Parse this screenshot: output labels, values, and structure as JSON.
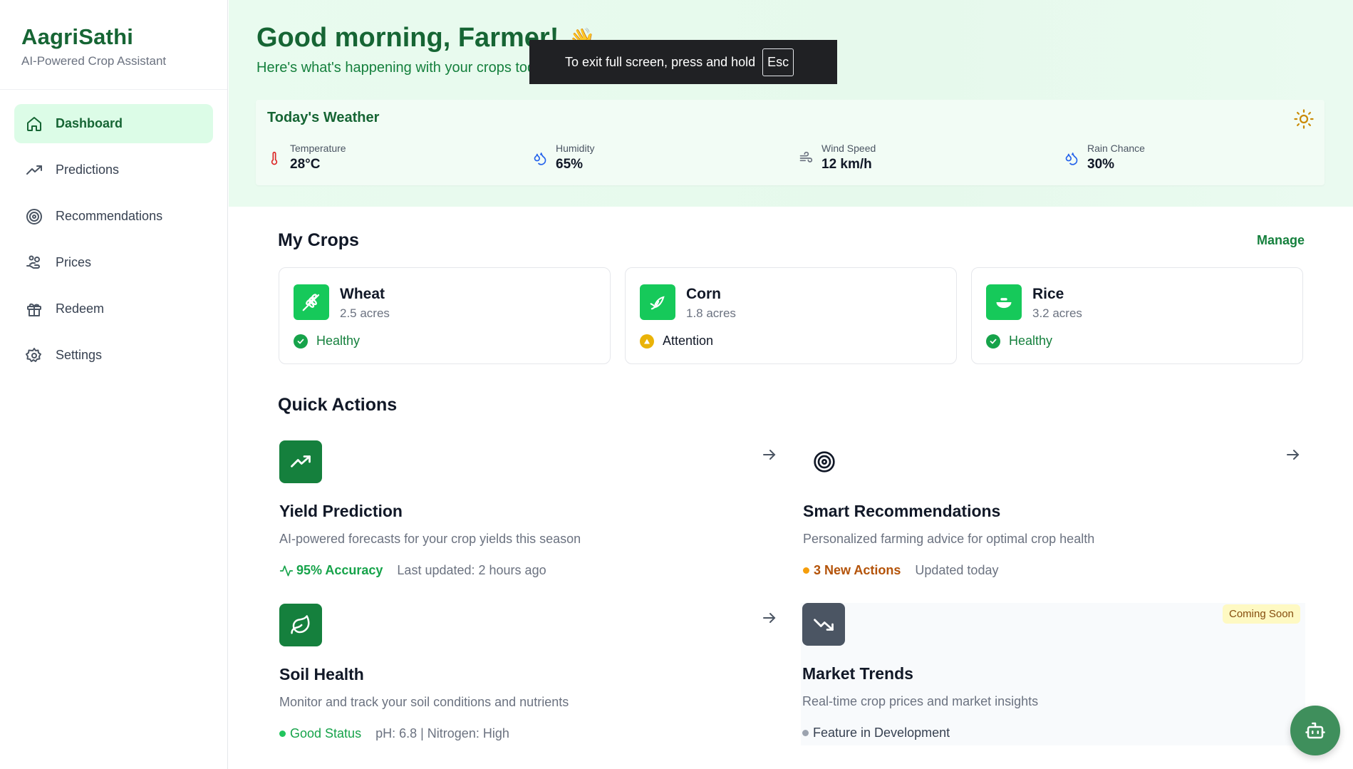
{
  "brand": {
    "name": "AagriSathi",
    "tagline": "AI-Powered Crop Assistant"
  },
  "nav": {
    "items": [
      {
        "label": "Dashboard",
        "icon": "home-icon",
        "active": true
      },
      {
        "label": "Predictions",
        "icon": "trending-up-icon"
      },
      {
        "label": "Recommendations",
        "icon": "target-icon"
      },
      {
        "label": "Prices",
        "icon": "hand-coins-icon"
      },
      {
        "label": "Redeem",
        "icon": "gift-icon"
      },
      {
        "label": "Settings",
        "icon": "gear-icon"
      }
    ]
  },
  "header": {
    "greeting": "Good morning, Farmer!",
    "wave": "👋",
    "subtitle": "Here's what's happening with your crops today"
  },
  "toast": {
    "text": "To exit full screen, press and hold",
    "key": "Esc"
  },
  "weather": {
    "title": "Today's Weather",
    "icon": "sun-icon",
    "stats": [
      {
        "label": "Temperature",
        "value": "28°C",
        "icon": "thermometer-icon",
        "color": "#dc2626"
      },
      {
        "label": "Humidity",
        "value": "65%",
        "icon": "droplets-icon",
        "color": "#2563eb"
      },
      {
        "label": "Wind Speed",
        "value": "12 km/h",
        "icon": "wind-icon",
        "color": "#6b7280"
      },
      {
        "label": "Rain Chance",
        "value": "30%",
        "icon": "droplets-icon",
        "color": "#2563eb"
      }
    ]
  },
  "crops": {
    "title": "My Crops",
    "manage": "Manage",
    "items": [
      {
        "name": "Wheat",
        "size": "2.5 acres",
        "status": "Healthy",
        "icon": "wheat-icon"
      },
      {
        "name": "Corn",
        "size": "1.8 acres",
        "status": "Attention",
        "icon": "corn-icon"
      },
      {
        "name": "Rice",
        "size": "3.2 acres",
        "status": "Healthy",
        "icon": "rice-bowl-icon"
      }
    ]
  },
  "quick_actions": {
    "title": "Quick Actions",
    "items": [
      {
        "title": "Yield Prediction",
        "desc": "AI-powered forecasts for your crop yields this season",
        "primary": "95% Accuracy",
        "secondary": "Last updated: 2 hours ago",
        "icon": "trending-up-icon"
      },
      {
        "title": "Smart Recommendations",
        "desc": "Personalized farming advice for optimal crop health",
        "primary": "3 New Actions",
        "secondary": "Updated today",
        "icon": "target-icon"
      },
      {
        "title": "Soil Health",
        "desc": "Monitor and track your soil conditions and nutrients",
        "primary": "Good Status",
        "secondary": "pH: 6.8 | Nitrogen: High",
        "icon": "leaf-icon"
      },
      {
        "title": "Market Trends",
        "desc": "Real-time crop prices and market insights",
        "primary": "Feature in Development",
        "badge": "Coming Soon",
        "icon": "trending-down-icon"
      }
    ]
  },
  "colors": {
    "brand": "#166534",
    "accent": "#15803d",
    "warning": "#eab308",
    "muted": "#6b7280"
  }
}
